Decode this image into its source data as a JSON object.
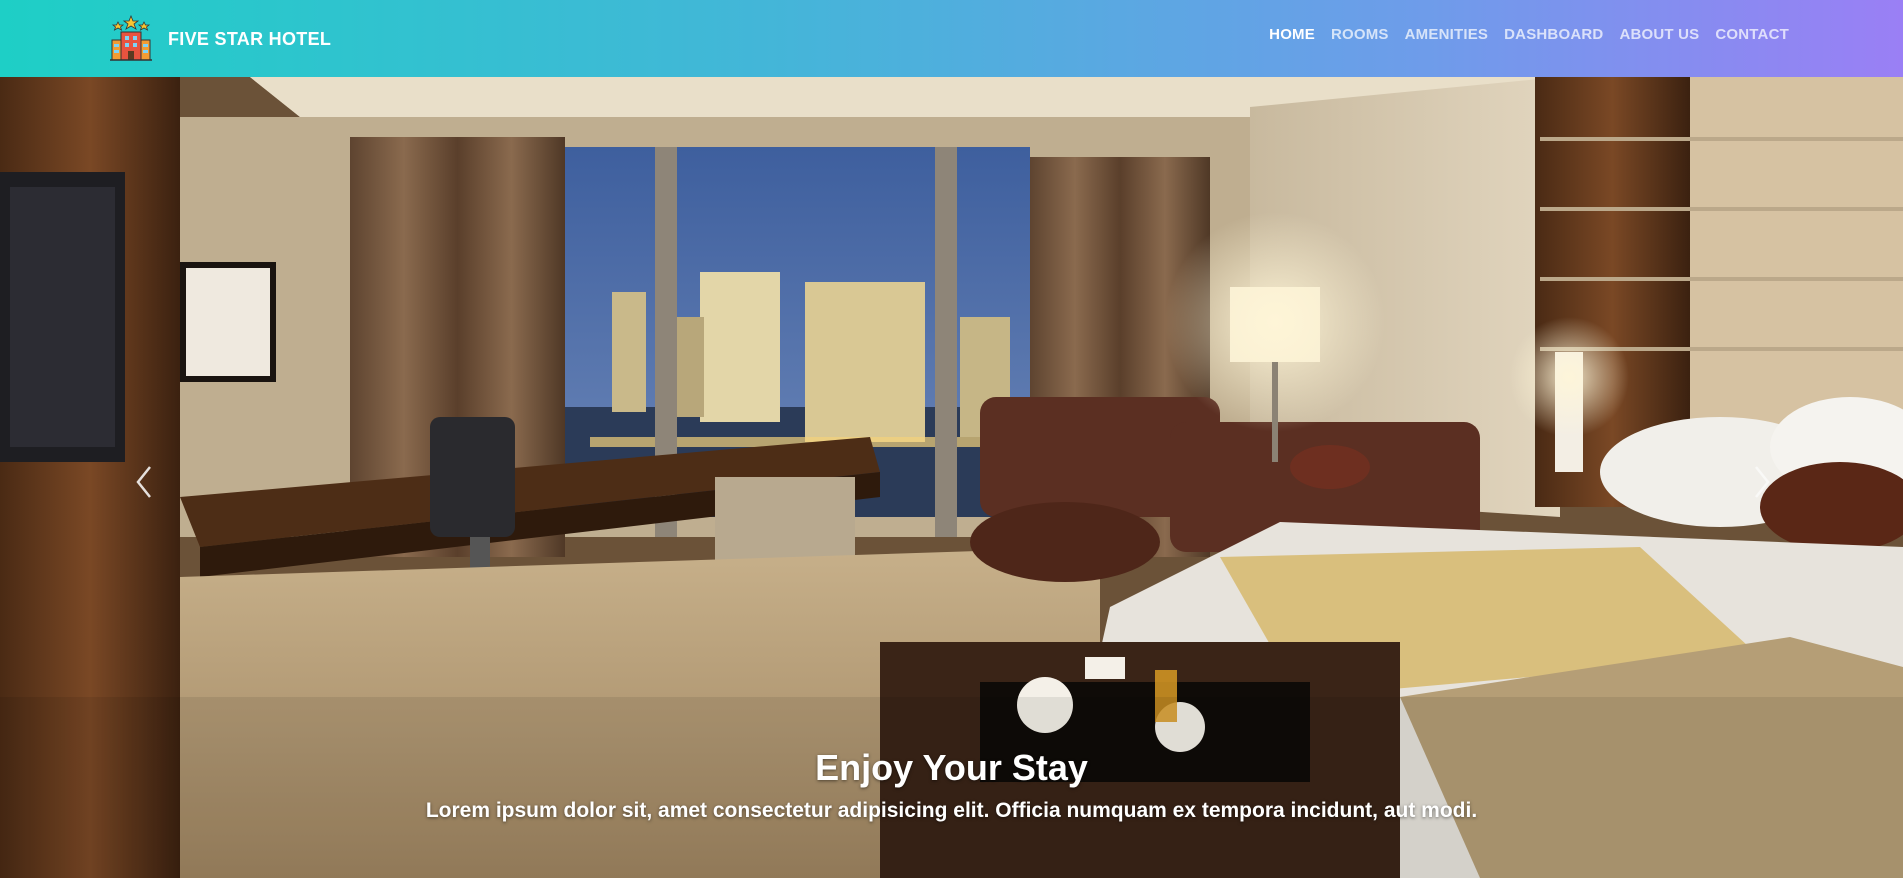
{
  "brand": {
    "name": "FIVE STAR HOTEL",
    "logo_icon": "hotel-building-stars-icon"
  },
  "nav": {
    "items": [
      {
        "label": "HOME",
        "active": true
      },
      {
        "label": "ROOMS",
        "active": false
      },
      {
        "label": "AMENITIES",
        "active": false
      },
      {
        "label": "DASHBOARD",
        "active": false
      },
      {
        "label": "ABOUT US",
        "active": false
      },
      {
        "label": "CONTACT",
        "active": false
      }
    ]
  },
  "hero": {
    "image_label": "hotel-room-photo",
    "caption_title": "Enjoy Your Stay",
    "caption_text": "Lorem ipsum dolor sit, amet consectetur adipisicing elit. Officia numquam ex tempora incidunt, aut modi.",
    "prev_icon": "chevron-left-icon",
    "next_icon": "chevron-right-icon"
  },
  "colors": {
    "nav_gradient_start": "#1ecfc6",
    "nav_gradient_end": "#9a7ff5",
    "nav_text": "#ffffff"
  }
}
